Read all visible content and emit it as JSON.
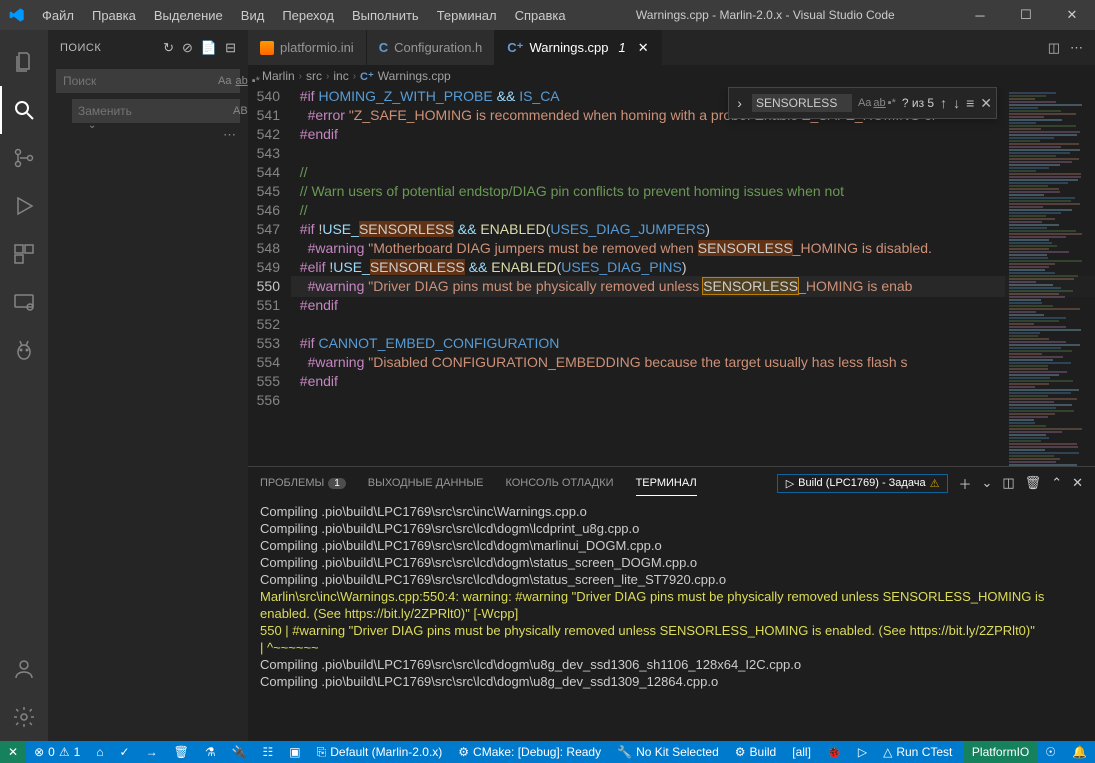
{
  "title": "Warnings.cpp - Marlin-2.0.x - Visual Studio Code",
  "menu": {
    "file": "Файл",
    "edit": "Правка",
    "selection": "Выделение",
    "view": "Вид",
    "goto": "Переход",
    "run": "Выполнить",
    "terminal": "Терминал",
    "help": "Справка"
  },
  "sidebar": {
    "title": "ПОИСК",
    "search_ph": "Поиск",
    "replace_ph": "Заменить"
  },
  "tabs": [
    {
      "label": "platformio.ini"
    },
    {
      "label": "Configuration.h"
    },
    {
      "label": "Warnings.cpp",
      "modified": "1"
    }
  ],
  "breadcrumbs": {
    "a": "Marlin",
    "b": "src",
    "c": "inc",
    "d": "Warnings.cpp"
  },
  "find": {
    "value": "SENSORLESS",
    "status": "? из 5"
  },
  "gutter": [
    "540",
    "541",
    "542",
    "543",
    "544",
    "545",
    "546",
    "547",
    "548",
    "549",
    "550",
    "551",
    "552",
    "553",
    "554",
    "555",
    "556"
  ],
  "panel": {
    "problems": "ПРОБЛЕМЫ",
    "problems_count": "1",
    "output": "ВЫХОДНЫЕ ДАННЫЕ",
    "debug": "КОНСОЛЬ ОТЛАДКИ",
    "terminal": "ТЕРМИНАЛ",
    "task": "Build (LPC1769) - Задача",
    "lines": [
      "Compiling .pio\\build\\LPC1769\\src\\src\\inc\\Warnings.cpp.o",
      "Compiling .pio\\build\\LPC1769\\src\\src\\lcd\\dogm\\lcdprint_u8g.cpp.o",
      "Compiling .pio\\build\\LPC1769\\src\\src\\lcd\\dogm\\marlinui_DOGM.cpp.o",
      "Compiling .pio\\build\\LPC1769\\src\\src\\lcd\\dogm\\status_screen_DOGM.cpp.o",
      "Compiling .pio\\build\\LPC1769\\src\\src\\lcd\\dogm\\status_screen_lite_ST7920.cpp.o"
    ],
    "warn1": "Marlin\\src\\inc\\Warnings.cpp:550:4: warning: #warning \"Driver DIAG pins must be physically removed unless SENSORLESS_HOMING is enabled. (See https://bit.ly/2ZPRlt0)\" [-Wcpp]",
    "warn2": "  550 |   #warning \"Driver DIAG pins must be physically removed unless SENSORLESS_HOMING is enabled. (See https://bit.ly/2ZPRlt0)\"",
    "warn3": "      |    ^~~~~~~",
    "lines2": [
      "Compiling .pio\\build\\LPC1769\\src\\src\\lcd\\dogm\\u8g_dev_ssd1306_sh1106_128x64_I2C.cpp.o",
      "Compiling .pio\\build\\LPC1769\\src\\src\\lcd\\dogm\\u8g_dev_ssd1309_12864.cpp.o"
    ]
  },
  "status": {
    "errwarn": "0",
    "warn": "1",
    "default": "Default (Marlin-2.0.x)",
    "cmake": "CMake: [Debug]: Ready",
    "kit": "No Kit Selected",
    "build": "Build",
    "all": "[all]",
    "ctest": "Run CTest",
    "platformio": "PlatformIO"
  }
}
